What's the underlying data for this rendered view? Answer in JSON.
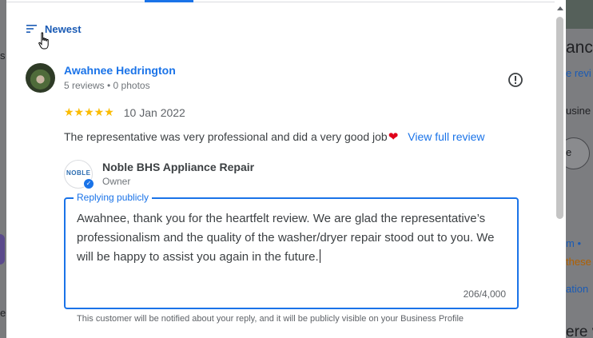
{
  "background": {
    "left_fragments": [
      "s",
      "e"
    ],
    "right_fragments": [
      "anc",
      "e revi",
      "usine",
      "e",
      "m •",
      "these",
      "ation",
      "ere vi"
    ]
  },
  "sort": {
    "label": "Newest",
    "icon": "sort-icon"
  },
  "review": {
    "reviewer_name": "Awahnee Hedrington",
    "reviewer_meta": "5 reviews • 0 photos",
    "stars": "★★★★★",
    "rating": 5,
    "date": "10 Jan 2022",
    "text": "The representative was very professional and did a very good job",
    "emoji": "❤",
    "full_review_link": "View full review"
  },
  "owner": {
    "logo_text": "NOBLE",
    "name": "Noble BHS Appliance Repair",
    "role": "Owner"
  },
  "reply": {
    "legend": "Replying publicly",
    "text": "Awahnee, thank you for the heartfelt review. We are glad the representative’s professionalism and the quality of the washer/dryer repair stood out to you. We will be happy to assist you again in the future.",
    "char_count": "206/4,000"
  },
  "notice": "This customer will be notified about your reply, and it will be publicly visible on your Business Profile",
  "colors": {
    "accent": "#1a73e8",
    "star": "#fbbc04",
    "heart": "#e0001b"
  }
}
